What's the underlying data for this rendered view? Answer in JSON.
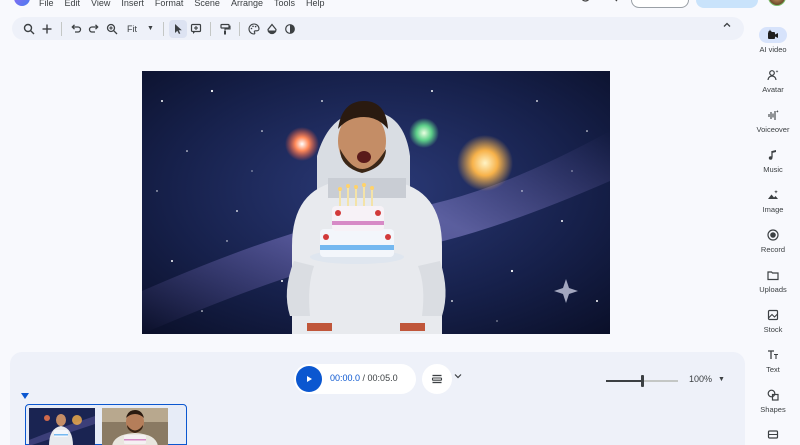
{
  "menu": {
    "items": [
      {
        "label": "File"
      },
      {
        "label": "Edit"
      },
      {
        "label": "View"
      },
      {
        "label": "Insert"
      },
      {
        "label": "Format"
      },
      {
        "label": "Scene"
      },
      {
        "label": "Arrange"
      },
      {
        "label": "Tools"
      },
      {
        "label": "Help"
      }
    ]
  },
  "toolbar": {
    "icons": [
      "search-icon",
      "plus-icon",
      "undo-icon",
      "redo-icon",
      "zoom-icon",
      "select-icon",
      "comment-icon",
      "paint-format-icon",
      "palette-icon",
      "fill-icon",
      "stroke-icon"
    ],
    "zoom_label": "Fit"
  },
  "right_panel": {
    "items": [
      {
        "label": "AI video",
        "icon": "ai-video-icon",
        "selected": true
      },
      {
        "label": "Avatar",
        "icon": "avatar-icon"
      },
      {
        "label": "Voiceover",
        "icon": "voiceover-icon"
      },
      {
        "label": "Music",
        "icon": "music-icon"
      },
      {
        "label": "Image",
        "icon": "image-icon"
      },
      {
        "label": "Record",
        "icon": "record-icon"
      },
      {
        "label": "Uploads",
        "icon": "uploads-icon"
      },
      {
        "label": "Stock",
        "icon": "stock-icon"
      },
      {
        "label": "Text",
        "icon": "text-icon"
      },
      {
        "label": "Shapes",
        "icon": "shapes-icon"
      }
    ]
  },
  "playback": {
    "current_time": "00:00.0",
    "separator": " / ",
    "total_time": "00:05.0"
  },
  "timeline": {
    "zoom_value": "100%",
    "zoom_level": 0.5,
    "scenes": [
      {
        "id": "scene-1",
        "subject": "astronaut"
      },
      {
        "id": "scene-2",
        "subject": "man-with-cake"
      }
    ]
  },
  "colors": {
    "accent": "#0b57d0",
    "selected_bg": "#d7e3fb",
    "panel_bg": "#eef1f9"
  }
}
